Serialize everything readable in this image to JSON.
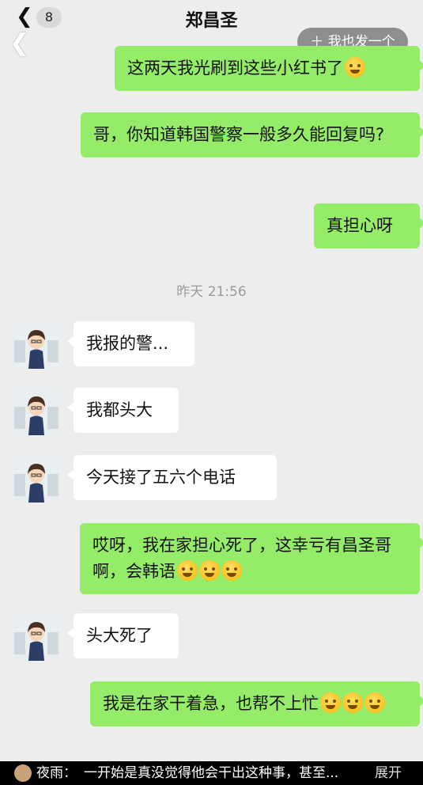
{
  "header": {
    "back_icon": "chevron-left-icon",
    "unread_count": "8",
    "title": "郑昌圣",
    "overlay_back_icon": "chevron-left-icon",
    "post_button_label": "＋ 我也发一个"
  },
  "messages": [
    {
      "from": "me",
      "text": "这两天我光刷到这些小红书了",
      "emoji": "laugh-cry"
    },
    {
      "from": "me",
      "text": "哥，你知道韩国警察一般多久能回复吗?"
    },
    {
      "from": "me",
      "text": "真担心呀"
    },
    {
      "from": "them",
      "text": "我报的警..."
    },
    {
      "from": "them",
      "text": "我都头大"
    },
    {
      "from": "them",
      "text": "今天接了五六个电话"
    },
    {
      "from": "me",
      "text": "哎呀，我在家担心死了，这幸亏有昌圣哥啊，会韩语",
      "emoji": "crying x3"
    },
    {
      "from": "them",
      "text": "头大死了"
    },
    {
      "from": "me",
      "text": "我是在家干着急，也帮不上忙",
      "emoji": "crying x3"
    }
  ],
  "timestamp": "昨天 21:56",
  "colors": {
    "my_bubble": "#95ec69",
    "their_bubble": "#ffffff",
    "background": "#ededed"
  },
  "comment_bar": {
    "name": "夜雨：",
    "text": "一开始是真没觉得他会干出这种事，甚至...",
    "expand": "展开"
  }
}
